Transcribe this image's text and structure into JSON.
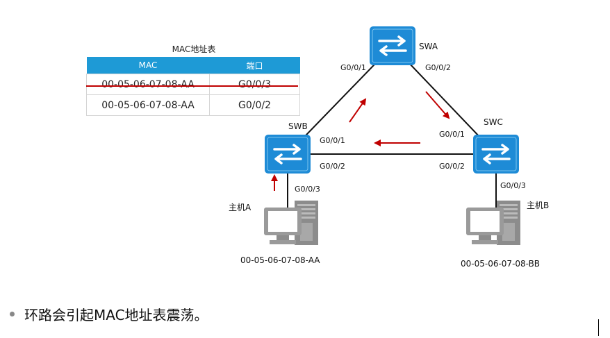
{
  "mac_table": {
    "title": "MAC地址表",
    "headers": [
      "MAC",
      "端口"
    ],
    "rows": [
      {
        "mac": "00-05-06-07-08-AA",
        "port": "G0/0/3",
        "struck": true
      },
      {
        "mac": "00-05-06-07-08-AA",
        "port": "G0/0/2",
        "struck": false
      }
    ]
  },
  "switches": {
    "swa": {
      "name": "SWA",
      "port_left": "G0/0/1",
      "port_right": "G0/0/2"
    },
    "swb": {
      "name": "SWB",
      "port_top": "G0/0/1",
      "port_bottom": "G0/0/2",
      "port_down": "G0/0/3"
    },
    "swc": {
      "name": "SWC",
      "port_top": "G0/0/1",
      "port_bottom": "G0/0/2",
      "port_down": "G0/0/3"
    }
  },
  "hosts": {
    "a": {
      "name": "主机A",
      "mac": "00-05-06-07-08-AA"
    },
    "b": {
      "name": "主机B",
      "mac": "00-05-06-07-08-BB"
    }
  },
  "bullet": {
    "text": "环路会引起MAC地址表震荡。"
  },
  "colors": {
    "switch": "#1e8bd6",
    "arrow": "#c00000",
    "header": "#1e9ad6"
  }
}
